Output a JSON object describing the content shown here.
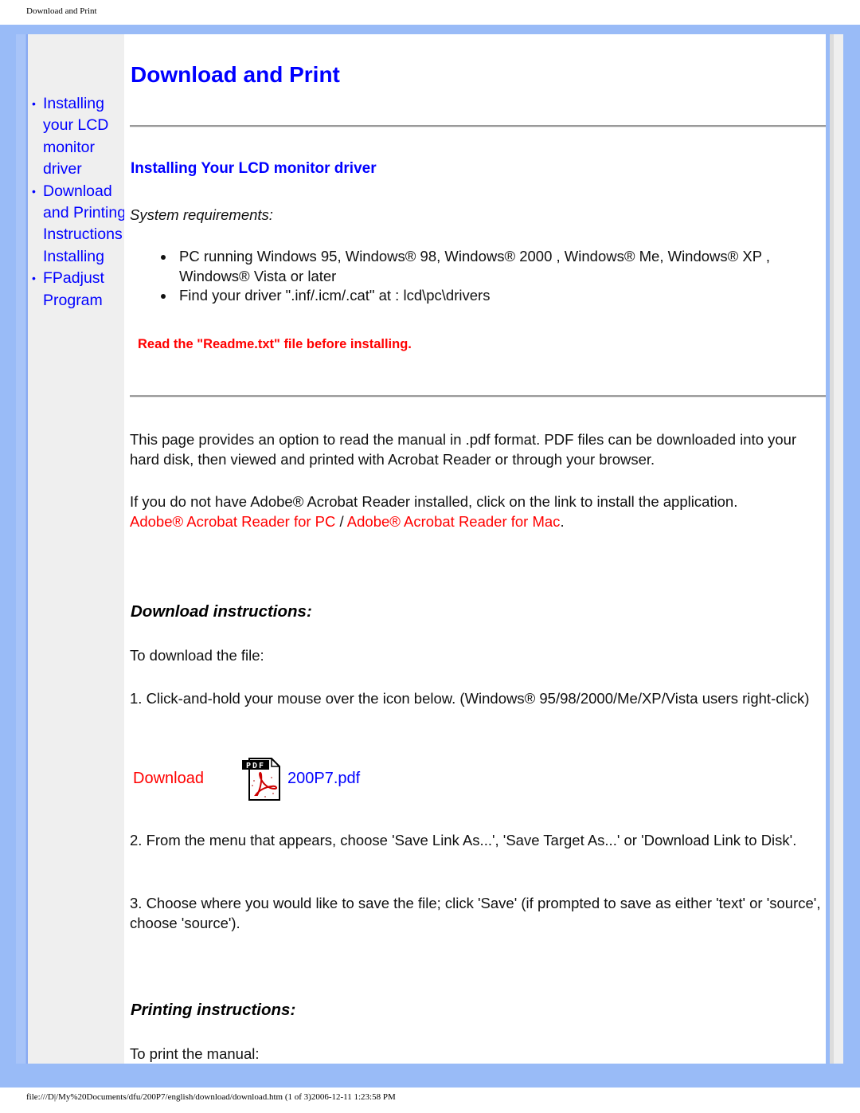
{
  "print_header": "Download and Print",
  "print_footer": "file:///D|/My%20Documents/dfu/200P7/english/download/download.htm (1 of 3)2006-12-11 1:23:58 PM",
  "sidebar": {
    "items": [
      {
        "label": "Installing your LCD monitor driver"
      },
      {
        "label": "Download and Printing Instructions"
      },
      {
        "extra": "Installing"
      },
      {
        "label": "FPadjust Program"
      }
    ]
  },
  "page_title": "Download and Print",
  "section_title": "Installing Your LCD monitor driver",
  "system_requirements_label": "System requirements:",
  "requirements": [
    "PC running Windows 95, Windows® 98, Windows® 2000 , Windows® Me, Windows® XP , Windows® Vista or later",
    "Find your driver \".inf/.icm/.cat\" at : lcd\\pc\\drivers"
  ],
  "readme_notice": "Read the \"Readme.txt\" file before installing.",
  "intro_paragraph": "This page provides an option to read the manual in .pdf format. PDF files can be downloaded into your hard disk, then viewed and printed with Acrobat Reader or through your browser.",
  "acrobat_paragraph": "If you do not have Adobe® Acrobat Reader installed, click on the link to install the application.",
  "acrobat_links": {
    "pc": "Adobe® Acrobat Reader for PC",
    "separator": " / ",
    "mac": "Adobe® Acrobat Reader for Mac",
    "end": "."
  },
  "download_instructions": {
    "heading": "Download instructions:",
    "intro": "To download the file:",
    "step1": "1. Click-and-hold your mouse over the icon below. (Windows® 95/98/2000/Me/XP/Vista users right-click)",
    "download_label": "Download",
    "pdf_icon_text": "PDF",
    "file_name": "200P7.pdf",
    "step2": "2. From the menu that appears, choose 'Save Link As...', 'Save Target As...' or 'Download Link to Disk'.",
    "step3": "3. Choose where you would like to save the file; click 'Save' (if prompted to save as either 'text' or 'source', choose 'source')."
  },
  "printing_instructions": {
    "heading": "Printing instructions:",
    "intro": "To print the manual:"
  },
  "colors": {
    "link_blue": "#0000ff",
    "alert_red": "#ff0000",
    "frame_blue": "#99bbf7",
    "sidebar_gray": "#efefef"
  }
}
